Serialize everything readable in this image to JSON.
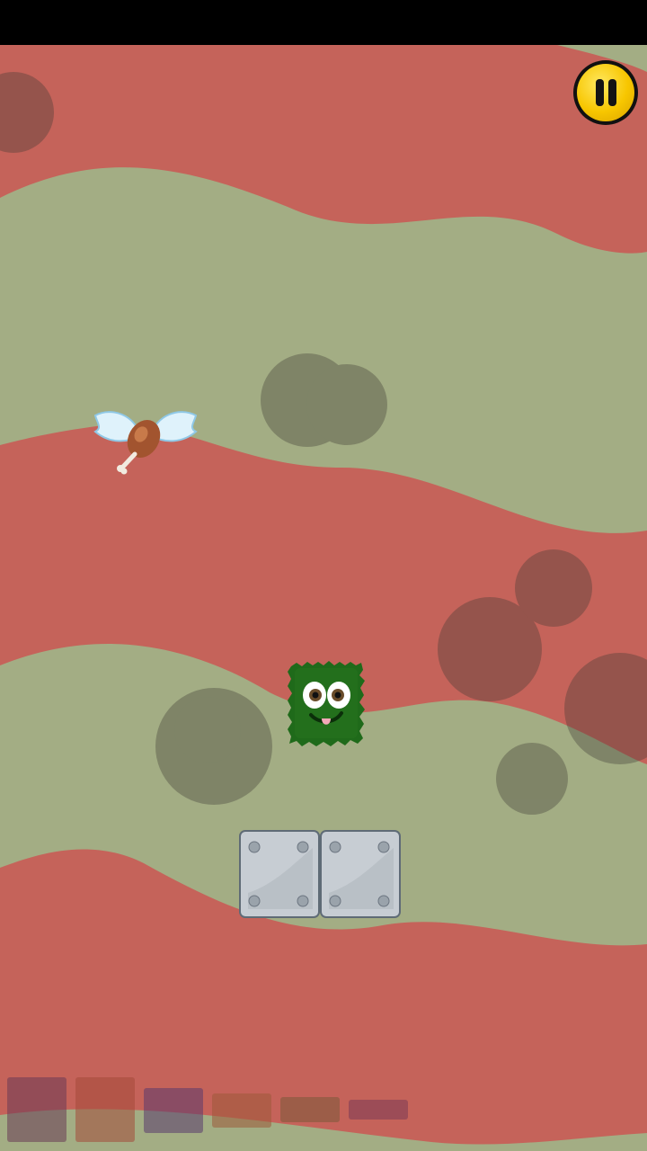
{
  "scene": {
    "stripe_colors": [
      "#c5635a",
      "#a3ad84"
    ],
    "bubble_color": "#3d3a33"
  },
  "hud": {
    "pause_icon": "pause-icon",
    "pause_color": "#f7c600"
  },
  "monster": {
    "icon": "green-fuzzy-monster",
    "color": "#1f6a1a"
  },
  "pickup": {
    "icon": "winged-drumstick-icon"
  },
  "platform": {
    "icon": "riveted-metal-block",
    "count": 2
  },
  "character_tray": {
    "colors": [
      "#6a3a55",
      "#a44a3a",
      "#5a3a6e",
      "#9c5a3a",
      "#7a5a3a",
      "#7a3a55"
    ]
  }
}
